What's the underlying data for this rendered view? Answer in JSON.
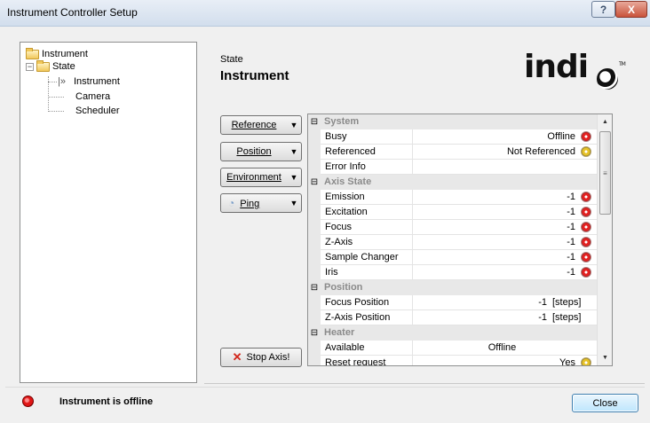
{
  "window": {
    "title": "Instrument Controller Setup",
    "help_label": "?",
    "close_label": "X"
  },
  "tree": {
    "root": "Instrument",
    "state": "State",
    "children": [
      "Instrument",
      "Camera",
      "Scheduler"
    ]
  },
  "header": {
    "subtitle": "State",
    "title": "Instrument",
    "logo": "indiGO",
    "logo_tm": "TM"
  },
  "buttons": {
    "reference": "Reference",
    "position": "Position",
    "environment": "Environment",
    "ping": "Ping",
    "stop_axis": "Stop Axis!",
    "close": "Close"
  },
  "grid": {
    "categories": {
      "system": "System",
      "axis_state": "Axis State",
      "position": "Position",
      "heater": "Heater"
    },
    "rows": {
      "busy": {
        "name": "Busy",
        "value": "Offline",
        "led": "red"
      },
      "referenced": {
        "name": "Referenced",
        "value": "Not Referenced",
        "led": "yellow"
      },
      "error_info": {
        "name": "Error Info",
        "value": ""
      },
      "emission": {
        "name": "Emission",
        "value": "-1",
        "led": "red"
      },
      "excitation": {
        "name": "Excitation",
        "value": "-1",
        "led": "red"
      },
      "focus": {
        "name": "Focus",
        "value": "-1",
        "led": "red"
      },
      "z_axis": {
        "name": "Z-Axis",
        "value": "-1",
        "led": "red"
      },
      "sample_changer": {
        "name": "Sample Changer",
        "value": "-1",
        "led": "red"
      },
      "iris": {
        "name": "Iris",
        "value": "-1",
        "led": "red"
      },
      "focus_position": {
        "name": "Focus Position",
        "value": "-1",
        "unit": "[steps]"
      },
      "z_axis_position": {
        "name": "Z-Axis Position",
        "value": "-1",
        "unit": "[steps]"
      },
      "available": {
        "name": "Available",
        "value": "Offline"
      },
      "reset_request": {
        "name": "Reset request",
        "value": "Yes",
        "led": "yellow"
      }
    }
  },
  "status": {
    "text": "Instrument is offline",
    "color": "#e01616"
  },
  "colors": {
    "led_red": "#e42222",
    "led_yellow": "#e6c229",
    "category_bg": "#e8e8e8"
  }
}
